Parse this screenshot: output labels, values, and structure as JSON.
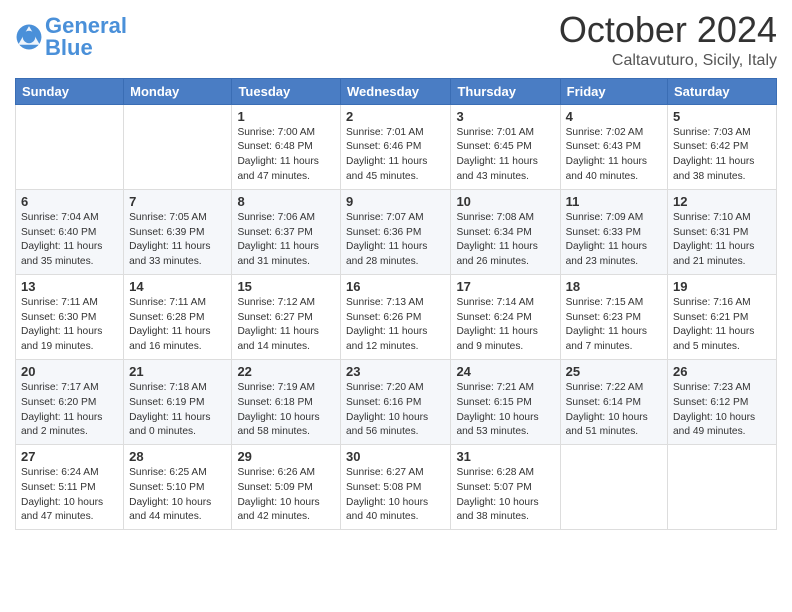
{
  "header": {
    "logo_general": "General",
    "logo_blue": "Blue",
    "month": "October 2024",
    "location": "Caltavuturo, Sicily, Italy"
  },
  "days_of_week": [
    "Sunday",
    "Monday",
    "Tuesday",
    "Wednesday",
    "Thursday",
    "Friday",
    "Saturday"
  ],
  "weeks": [
    [
      {
        "day": null,
        "info": null
      },
      {
        "day": null,
        "info": null
      },
      {
        "day": "1",
        "info": "Sunrise: 7:00 AM\nSunset: 6:48 PM\nDaylight: 11 hours and 47 minutes."
      },
      {
        "day": "2",
        "info": "Sunrise: 7:01 AM\nSunset: 6:46 PM\nDaylight: 11 hours and 45 minutes."
      },
      {
        "day": "3",
        "info": "Sunrise: 7:01 AM\nSunset: 6:45 PM\nDaylight: 11 hours and 43 minutes."
      },
      {
        "day": "4",
        "info": "Sunrise: 7:02 AM\nSunset: 6:43 PM\nDaylight: 11 hours and 40 minutes."
      },
      {
        "day": "5",
        "info": "Sunrise: 7:03 AM\nSunset: 6:42 PM\nDaylight: 11 hours and 38 minutes."
      }
    ],
    [
      {
        "day": "6",
        "info": "Sunrise: 7:04 AM\nSunset: 6:40 PM\nDaylight: 11 hours and 35 minutes."
      },
      {
        "day": "7",
        "info": "Sunrise: 7:05 AM\nSunset: 6:39 PM\nDaylight: 11 hours and 33 minutes."
      },
      {
        "day": "8",
        "info": "Sunrise: 7:06 AM\nSunset: 6:37 PM\nDaylight: 11 hours and 31 minutes."
      },
      {
        "day": "9",
        "info": "Sunrise: 7:07 AM\nSunset: 6:36 PM\nDaylight: 11 hours and 28 minutes."
      },
      {
        "day": "10",
        "info": "Sunrise: 7:08 AM\nSunset: 6:34 PM\nDaylight: 11 hours and 26 minutes."
      },
      {
        "day": "11",
        "info": "Sunrise: 7:09 AM\nSunset: 6:33 PM\nDaylight: 11 hours and 23 minutes."
      },
      {
        "day": "12",
        "info": "Sunrise: 7:10 AM\nSunset: 6:31 PM\nDaylight: 11 hours and 21 minutes."
      }
    ],
    [
      {
        "day": "13",
        "info": "Sunrise: 7:11 AM\nSunset: 6:30 PM\nDaylight: 11 hours and 19 minutes."
      },
      {
        "day": "14",
        "info": "Sunrise: 7:11 AM\nSunset: 6:28 PM\nDaylight: 11 hours and 16 minutes."
      },
      {
        "day": "15",
        "info": "Sunrise: 7:12 AM\nSunset: 6:27 PM\nDaylight: 11 hours and 14 minutes."
      },
      {
        "day": "16",
        "info": "Sunrise: 7:13 AM\nSunset: 6:26 PM\nDaylight: 11 hours and 12 minutes."
      },
      {
        "day": "17",
        "info": "Sunrise: 7:14 AM\nSunset: 6:24 PM\nDaylight: 11 hours and 9 minutes."
      },
      {
        "day": "18",
        "info": "Sunrise: 7:15 AM\nSunset: 6:23 PM\nDaylight: 11 hours and 7 minutes."
      },
      {
        "day": "19",
        "info": "Sunrise: 7:16 AM\nSunset: 6:21 PM\nDaylight: 11 hours and 5 minutes."
      }
    ],
    [
      {
        "day": "20",
        "info": "Sunrise: 7:17 AM\nSunset: 6:20 PM\nDaylight: 11 hours and 2 minutes."
      },
      {
        "day": "21",
        "info": "Sunrise: 7:18 AM\nSunset: 6:19 PM\nDaylight: 11 hours and 0 minutes."
      },
      {
        "day": "22",
        "info": "Sunrise: 7:19 AM\nSunset: 6:18 PM\nDaylight: 10 hours and 58 minutes."
      },
      {
        "day": "23",
        "info": "Sunrise: 7:20 AM\nSunset: 6:16 PM\nDaylight: 10 hours and 56 minutes."
      },
      {
        "day": "24",
        "info": "Sunrise: 7:21 AM\nSunset: 6:15 PM\nDaylight: 10 hours and 53 minutes."
      },
      {
        "day": "25",
        "info": "Sunrise: 7:22 AM\nSunset: 6:14 PM\nDaylight: 10 hours and 51 minutes."
      },
      {
        "day": "26",
        "info": "Sunrise: 7:23 AM\nSunset: 6:12 PM\nDaylight: 10 hours and 49 minutes."
      }
    ],
    [
      {
        "day": "27",
        "info": "Sunrise: 6:24 AM\nSunset: 5:11 PM\nDaylight: 10 hours and 47 minutes."
      },
      {
        "day": "28",
        "info": "Sunrise: 6:25 AM\nSunset: 5:10 PM\nDaylight: 10 hours and 44 minutes."
      },
      {
        "day": "29",
        "info": "Sunrise: 6:26 AM\nSunset: 5:09 PM\nDaylight: 10 hours and 42 minutes."
      },
      {
        "day": "30",
        "info": "Sunrise: 6:27 AM\nSunset: 5:08 PM\nDaylight: 10 hours and 40 minutes."
      },
      {
        "day": "31",
        "info": "Sunrise: 6:28 AM\nSunset: 5:07 PM\nDaylight: 10 hours and 38 minutes."
      },
      {
        "day": null,
        "info": null
      },
      {
        "day": null,
        "info": null
      }
    ]
  ]
}
